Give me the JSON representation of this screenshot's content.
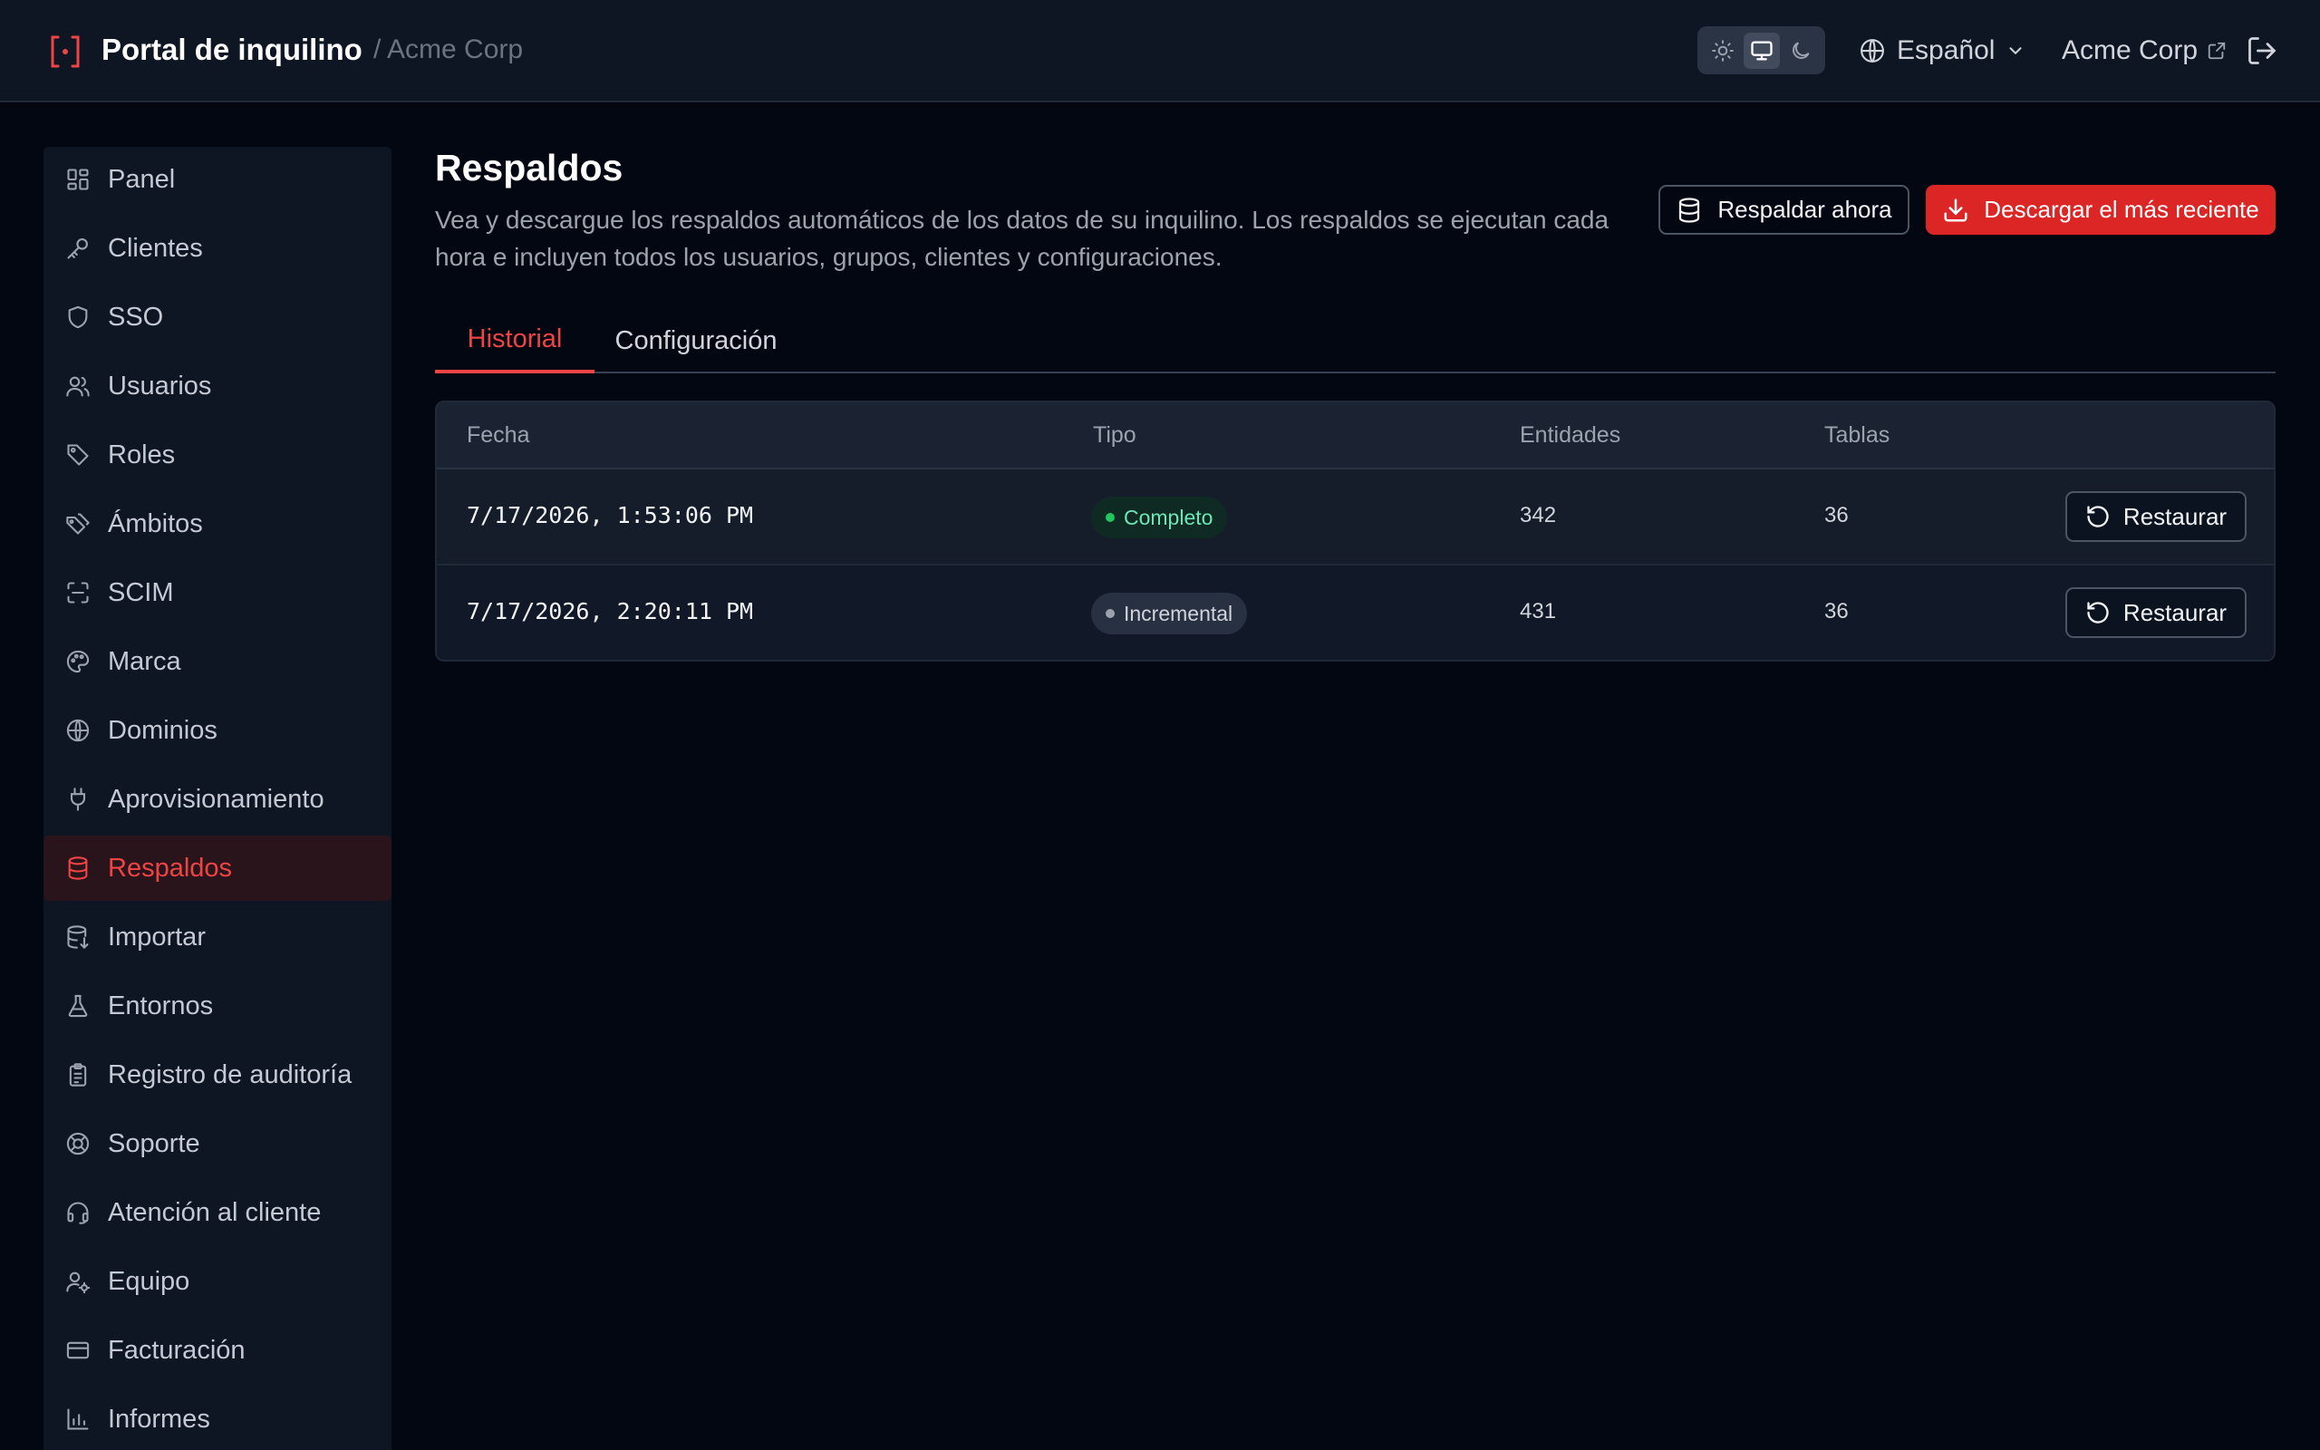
{
  "header": {
    "title": "Portal de inquilino",
    "breadcrumb": "/ Acme Corp",
    "theme_modes": [
      "light",
      "system",
      "dark"
    ],
    "theme_selected": "system",
    "language": "Español",
    "tenant": "Acme Corp"
  },
  "sidebar": {
    "items": [
      {
        "label": "Panel",
        "icon": "dashboard-icon"
      },
      {
        "label": "Clientes",
        "icon": "key-icon"
      },
      {
        "label": "SSO",
        "icon": "shield-icon"
      },
      {
        "label": "Usuarios",
        "icon": "users-icon"
      },
      {
        "label": "Roles",
        "icon": "tag-icon"
      },
      {
        "label": "Ámbitos",
        "icon": "tags-icon"
      },
      {
        "label": "SCIM",
        "icon": "scan-icon"
      },
      {
        "label": "Marca",
        "icon": "palette-icon"
      },
      {
        "label": "Dominios",
        "icon": "globe-icon"
      },
      {
        "label": "Aprovisionamiento",
        "icon": "plug-icon"
      },
      {
        "label": "Respaldos",
        "icon": "database-icon",
        "active": true
      },
      {
        "label": "Importar",
        "icon": "database-import-icon"
      },
      {
        "label": "Entornos",
        "icon": "flask-icon"
      },
      {
        "label": "Registro de auditoría",
        "icon": "clipboard-icon"
      },
      {
        "label": "Soporte",
        "icon": "lifebuoy-icon"
      },
      {
        "label": "Atención al cliente",
        "icon": "headset-icon"
      },
      {
        "label": "Equipo",
        "icon": "user-cog-icon"
      },
      {
        "label": "Facturación",
        "icon": "credit-card-icon"
      },
      {
        "label": "Informes",
        "icon": "bar-chart-icon"
      }
    ]
  },
  "main": {
    "title": "Respaldos",
    "description": "Vea y descargue los respaldos automáticos de los datos de su inquilino. Los respaldos se ejecutan cada hora e incluyen todos los usuarios, grupos, clientes y configuraciones.",
    "backup_now_label": "Respaldar ahora",
    "download_latest_label": "Descargar el más reciente",
    "tabs": [
      {
        "label": "Historial",
        "active": true
      },
      {
        "label": "Configuración",
        "active": false
      }
    ],
    "table": {
      "columns": [
        "Fecha",
        "Tipo",
        "Entidades",
        "Tablas",
        ""
      ],
      "rows": [
        {
          "date": "7/17/2026, 1:53:06 PM",
          "type": "Completo",
          "entities": "342",
          "tables": "36",
          "action": "Restaurar"
        },
        {
          "date": "7/17/2026, 2:20:11 PM",
          "type": "Incremental",
          "entities": "431",
          "tables": "36",
          "action": "Restaurar"
        }
      ]
    }
  },
  "colors": {
    "accent": "#ef4444",
    "primary_button": "#dc2626",
    "background": "#030712",
    "panel": "#0e1624",
    "status_complete": "#22c55e"
  }
}
